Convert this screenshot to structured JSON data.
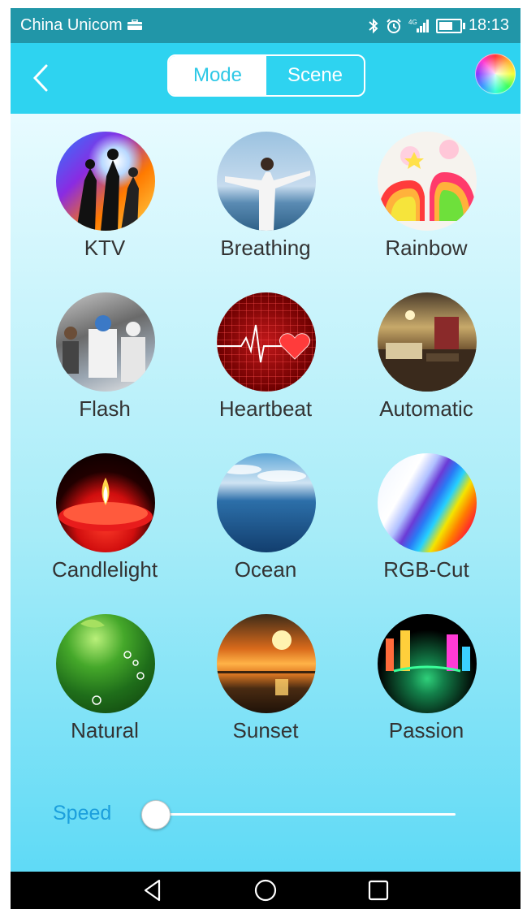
{
  "status_bar": {
    "carrier": "China Unicom",
    "time": "18:13",
    "icons": [
      "briefcase-icon",
      "bluetooth-icon",
      "alarm-icon",
      "signal-4g-icon",
      "battery-icon"
    ]
  },
  "header": {
    "back_icon": "chevron-left-icon",
    "tabs": [
      {
        "label": "Mode",
        "active": true
      },
      {
        "label": "Scene",
        "active": false
      }
    ],
    "color_picker_icon": "color-wheel-icon"
  },
  "modes": [
    {
      "label": "KTV"
    },
    {
      "label": "Breathing"
    },
    {
      "label": "Rainbow"
    },
    {
      "label": "Flash"
    },
    {
      "label": "Heartbeat"
    },
    {
      "label": "Automatic"
    },
    {
      "label": "Candlelight"
    },
    {
      "label": "Ocean"
    },
    {
      "label": "RGB-Cut"
    },
    {
      "label": "Natural"
    },
    {
      "label": "Sunset"
    },
    {
      "label": "Passion"
    }
  ],
  "speed": {
    "label": "Speed",
    "value": 0
  },
  "nav_bar": {
    "icons": [
      "back-triangle-icon",
      "home-circle-icon",
      "recents-square-icon"
    ]
  },
  "colors": {
    "status_bar": "#2196a8",
    "header": "#2ed3f0",
    "accent": "#1c9fdc",
    "label_text": "#333333"
  }
}
